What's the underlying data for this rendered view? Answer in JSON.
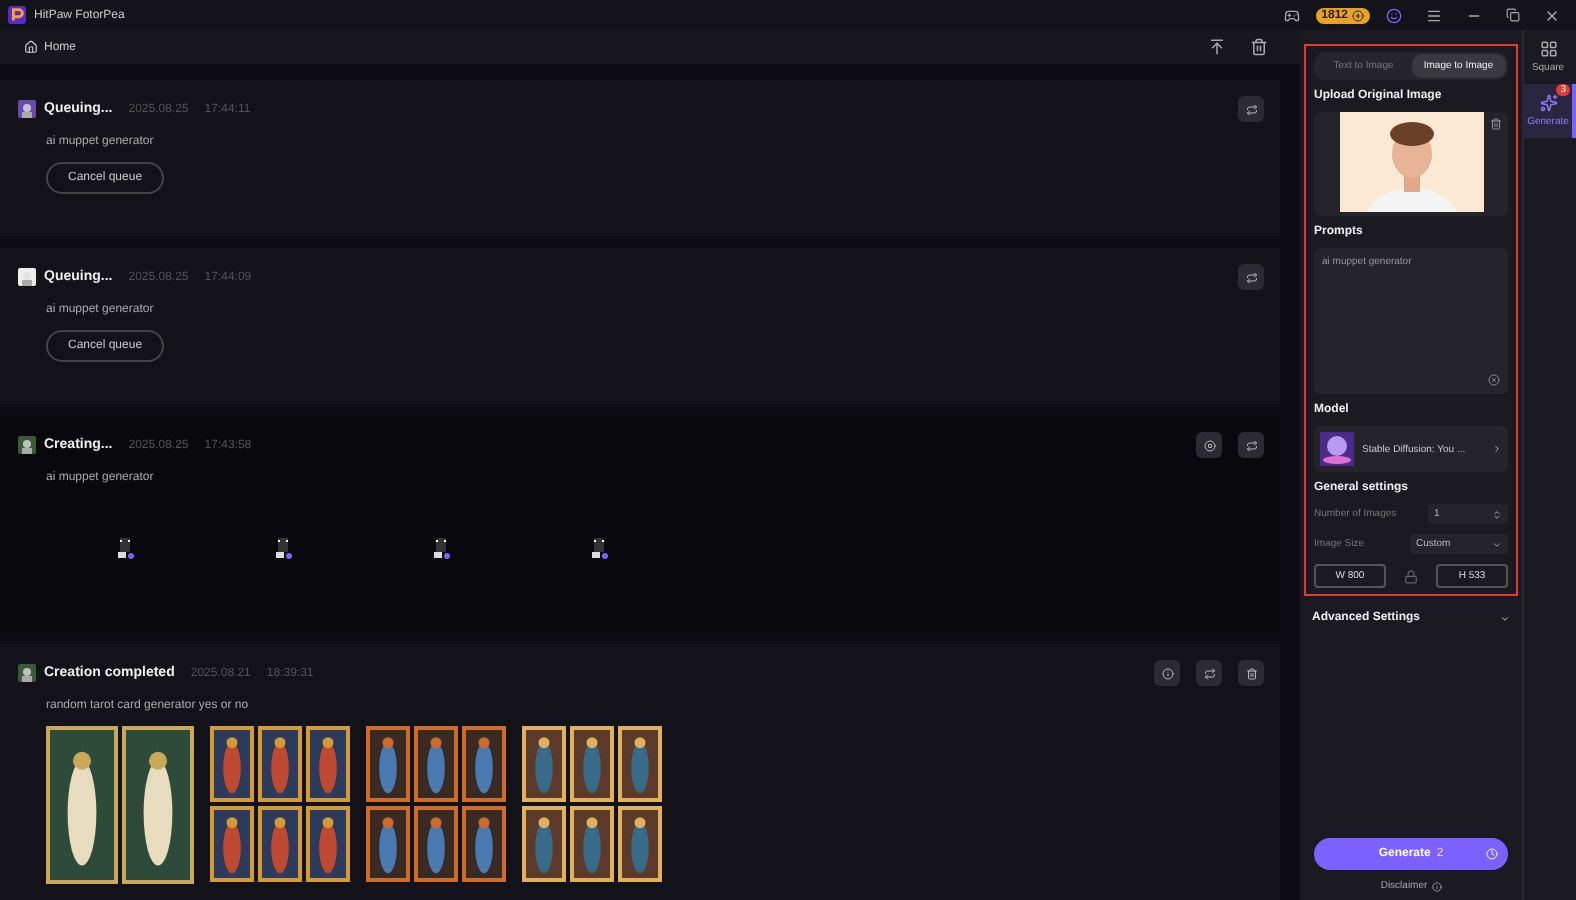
{
  "app": {
    "title": "HitPaw FotorPea",
    "credits": "1812"
  },
  "nav": {
    "home": "Home"
  },
  "feed": [
    {
      "kind": "queuing",
      "status": "Queuing...",
      "date": "2025.08.25",
      "time": "17:44:11",
      "prompt": "ai muppet generator",
      "button": "Cancel queue"
    },
    {
      "kind": "queuing",
      "status": "Queuing...",
      "date": "2025.08.25",
      "time": "17:44:09",
      "prompt": "ai muppet generator",
      "button": "Cancel queue"
    },
    {
      "kind": "creating",
      "status": "Creating...",
      "date": "2025.08.25",
      "time": "17:43:58",
      "prompt": "ai muppet generator"
    },
    {
      "kind": "completed",
      "status": "Creation completed",
      "date": "2025.08.21",
      "time": "18:39:31",
      "prompt": "random tarot card generator yes or no"
    }
  ],
  "panel": {
    "tabs": [
      {
        "label": "Text to Image",
        "selected": false
      },
      {
        "label": "Image to Image",
        "selected": true
      }
    ],
    "upload_title": "Upload Original Image",
    "prompts_title": "Prompts",
    "prompt": "ai muppet generator",
    "model_title": "Model",
    "model_name": "Stable Diffusion: You ...",
    "general_title": "General settings",
    "number_label": "Number of Images",
    "number_value": "1",
    "size_label": "Image Size",
    "size_value": "Custom",
    "width": "W 800",
    "height": "H 533",
    "advanced": "Advanced Settings",
    "generate": "Generate",
    "cost": "2",
    "disclaimer": "Disclaimer"
  },
  "sidebar": [
    {
      "label": "Square",
      "selected": false
    },
    {
      "label": "Generate",
      "selected": true,
      "badge": "3"
    }
  ]
}
